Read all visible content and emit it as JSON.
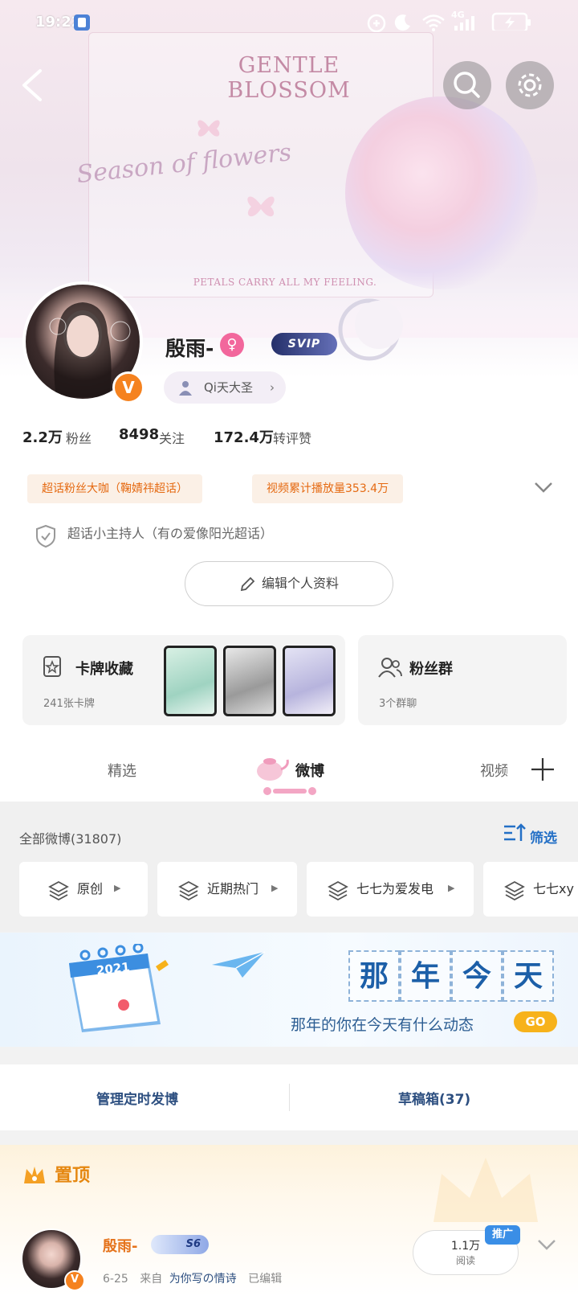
{
  "status_bar": {
    "time": "19:22",
    "network": "4G"
  },
  "banner": {
    "title": "GENTLE BLOSSOM",
    "script_text": "Season of flowers",
    "subtitle": "PETALS CARRY ALL MY FEELING."
  },
  "profile": {
    "name": "殷雨-",
    "gender_icon": "female-icon",
    "svip_label": "SVIP",
    "title_pill": "Qi天大圣",
    "stats": [
      {
        "value": "2.2万",
        "label": "粉丝"
      },
      {
        "value": "8498",
        "label": "关注"
      },
      {
        "value": "172.4万",
        "label": "转评赞"
      }
    ],
    "tags": [
      "超话粉丝大咖（鞠婧祎超话）",
      "视频累计播放量353.4万"
    ],
    "host_text": "超话小主持人（有の爱像阳光超话）",
    "edit_button": "编辑个人资料"
  },
  "cards": {
    "collection": {
      "title": "卡牌收藏",
      "sub": "241张卡牌"
    },
    "fans_group": {
      "title": "粉丝群",
      "sub": "3个群聊"
    }
  },
  "tabs": [
    {
      "label": "精选"
    },
    {
      "label": "微博"
    },
    {
      "label": "视频"
    }
  ],
  "active_tab": 1,
  "feed_header": {
    "all_label": "全部微博(31807)",
    "filter_label": "筛选"
  },
  "chips": [
    "原创",
    "近期热门",
    "七七为爱发电",
    "七七xy"
  ],
  "promo": {
    "calendar_year": "2021",
    "chars": [
      "那",
      "年",
      "今",
      "天"
    ],
    "sub": "那年的你在今天有什么动态",
    "go": "GO"
  },
  "manage": {
    "scheduled": "管理定时发博",
    "drafts": "草稿箱(37)"
  },
  "pinned": {
    "label": "置顶",
    "post_name": "殷雨-",
    "level_badge": "S6",
    "date": "6-25",
    "source_prefix": "来自",
    "source": "为你写の情诗",
    "edited": "已编辑",
    "reads_value": "1.1万",
    "reads_label": "阅读",
    "promo_badge": "推广"
  },
  "colors": {
    "accent_orange": "#e5721a",
    "tag_orange": "#e56a12",
    "promo_blue": "#1c5fa8",
    "gold": "#f7b21b"
  }
}
